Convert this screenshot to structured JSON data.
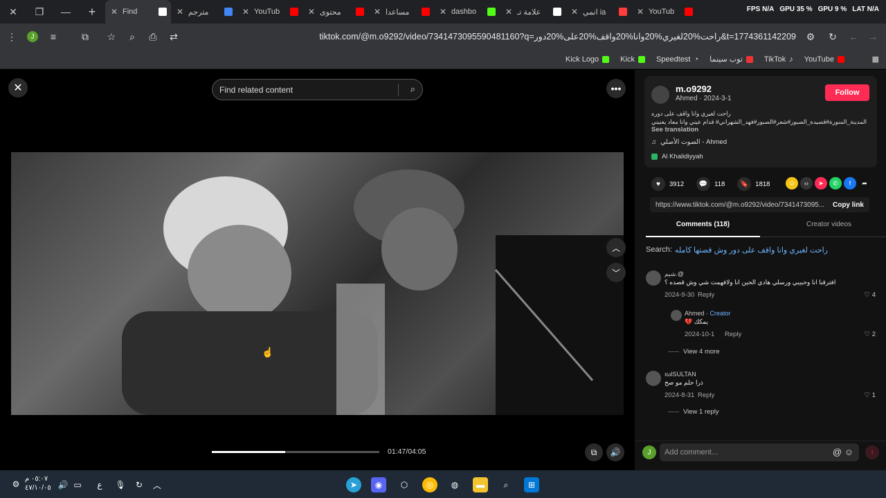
{
  "browser": {
    "tabs": [
      {
        "title": "Find",
        "active": true,
        "color": "#ffffff"
      },
      {
        "title": "مترجم",
        "color": "#4285f4"
      },
      {
        "title": "YouTub",
        "color": "#ff0000"
      },
      {
        "title": "محتوى",
        "color": "#ff0000"
      },
      {
        "title": "مساعدا",
        "color": "#ff0000"
      },
      {
        "title": "dashbo",
        "color": "#53fc18"
      },
      {
        "title": "علامة تـ",
        "color": "#ffffff"
      },
      {
        "title": "انمي ia",
        "color": "#ff3d3d"
      },
      {
        "title": "YouTub",
        "color": "#ff0000"
      }
    ],
    "perf": {
      "fps": "FPS N/A",
      "gpu1": "GPU 35 %",
      "gpu2": "GPU 9 %",
      "lat": "LAT N/A"
    },
    "url": "tiktok.com/@m.o9292/video/7341473095590481160?q=راحت%20لغيري%20وانا%20واقف%20على%20دور&t=1774361142209",
    "profile_letter": "J",
    "bookmarks": [
      "Kick Logo",
      "Kick",
      "Speedtest",
      "توب سينما",
      "TikTok",
      "YouTube"
    ]
  },
  "viewer": {
    "search_placeholder": "Find related content",
    "time": "01:47/04:05",
    "progress": 0.437
  },
  "post": {
    "username": "m.o9292",
    "meta": "Ahmed · 2024-3-1",
    "follow": "Follow",
    "description": "راحت لغيري وانا واقف على دوره المدينة_المنورة#قصيدة_الصبور#شعر#الصبور#فهد_الشهراني# قدام عيني وانا معاد يعنيني",
    "see_translation": "See translation",
    "music": "الصوت الأصلي - Ahmed",
    "location": "Al Khalidiyyah",
    "likes": "3912",
    "comments_count": "118",
    "saves": "1818",
    "link": "https://www.tiktok.com/@m.o9292/video/7341473095...",
    "copy_link": "Copy link",
    "tab_comments": "Comments (118)",
    "tab_creator": "Creator videos",
    "search_label": "Search:",
    "search_query": "راحت لغيري وانا واقف على دور وش قصتها كامله"
  },
  "comments": [
    {
      "user": "شيم.@",
      "text": "افترقنا انا وحبيبي ورسلي هادي الحين انا ولافهمت شي وش قصده ؟",
      "date": "2024-9-30",
      "reply": "Reply",
      "likes": "4"
    },
    {
      "user": "Ahmed",
      "creator": "Creator",
      "text": "يمكك 💔",
      "date": "2024-10-1",
      "reply": "Reply",
      "likes": "2"
    },
    {
      "user": "ıωlSULTAN",
      "text": "ذرا حلم مو صح",
      "date": "2024-8-31",
      "reply": "Reply",
      "likes": "1"
    }
  ],
  "view_more": "View 4 more",
  "view_reply": "View 1 reply",
  "add_comment": "Add comment...",
  "taskbar": {
    "time": "٠٥:٠٧ م",
    "date": "٤٧/١٠/٠٥",
    "lang": "ع"
  }
}
